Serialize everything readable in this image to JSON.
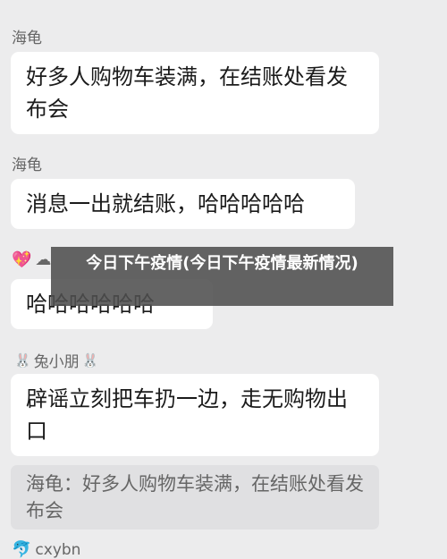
{
  "messages": [
    {
      "sender": "海龟",
      "text": "好多人购物车装满，在结账处看发布会"
    },
    {
      "sender": "海龟",
      "text": "消息一出就结账，哈哈哈哈哈"
    },
    {
      "sender_icons": [
        "💖",
        "☁"
      ],
      "text": "哈哈哈哈哈哈"
    },
    {
      "sender": "兔小朋",
      "sender_icon": "🐰",
      "text": "辟谣立刻把车扔一边，走无购物出口",
      "quote": "海龟：好多人购物车装满，在结账处看发布会"
    },
    {
      "sender": "cxybn",
      "sender_icon": "🐬"
    }
  ],
  "overlay": {
    "title": "今日下午疫情(今日下午疫情最新情况)"
  },
  "colors": {
    "background": "#ececed",
    "bubble": "#ffffff",
    "quote_bg": "#e0e0e2",
    "overlay": "#4e4e4e"
  }
}
